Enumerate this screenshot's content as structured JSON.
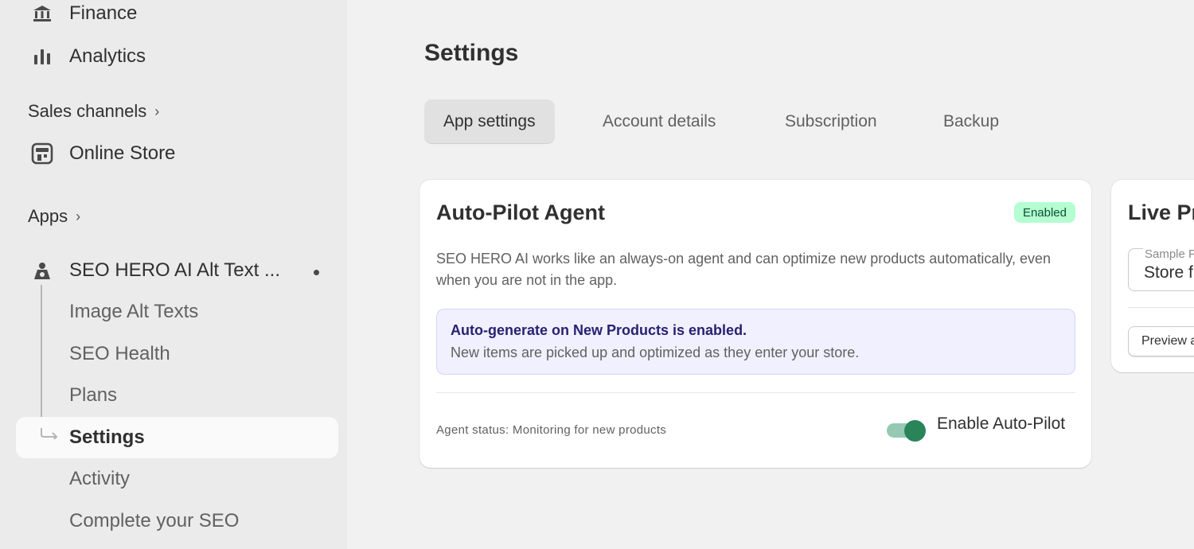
{
  "sidebar": {
    "top_items": [
      {
        "label": "Finance",
        "icon": "bank-icon"
      },
      {
        "label": "Analytics",
        "icon": "bar-chart-icon"
      }
    ],
    "sales_channels": {
      "label": "Sales channels",
      "chevron": "›"
    },
    "online_store": {
      "label": "Online Store",
      "icon": "store-icon"
    },
    "apps": {
      "label": "Apps",
      "chevron": "›"
    },
    "app": {
      "label": "SEO HERO AI Alt Text ...",
      "icon": "app-logo-icon",
      "subitems": [
        {
          "label": "Image Alt Texts"
        },
        {
          "label": "SEO Health"
        },
        {
          "label": "Plans"
        },
        {
          "label": "Settings",
          "active": true
        },
        {
          "label": "Activity"
        },
        {
          "label": "Complete your SEO"
        }
      ]
    }
  },
  "main": {
    "title": "Settings",
    "tabs": [
      {
        "label": "App settings",
        "active": true
      },
      {
        "label": "Account details"
      },
      {
        "label": "Subscription"
      },
      {
        "label": "Backup"
      }
    ],
    "autopilot_card": {
      "title": "Auto-Pilot Agent",
      "badge": "Enabled",
      "description": "SEO HERO AI works like an always-on agent and can optimize new products automatically, even when you are not in the app.",
      "banner_title": "Auto-generate on New Products is enabled.",
      "banner_text": "New items are picked up and optimized as they enter your store.",
      "status": "Agent status: Monitoring for new products",
      "toggle_label": "Enable Auto-Pilot",
      "toggle_on": true
    },
    "live_card": {
      "title": "Live Pr",
      "field_label": "Sample P",
      "field_value": "Store f",
      "button_label": "Preview a"
    }
  },
  "colors": {
    "badge_bg": "#b4fed2",
    "toggle_on": "#29845a",
    "banner_bg": "#f0f0ff"
  }
}
